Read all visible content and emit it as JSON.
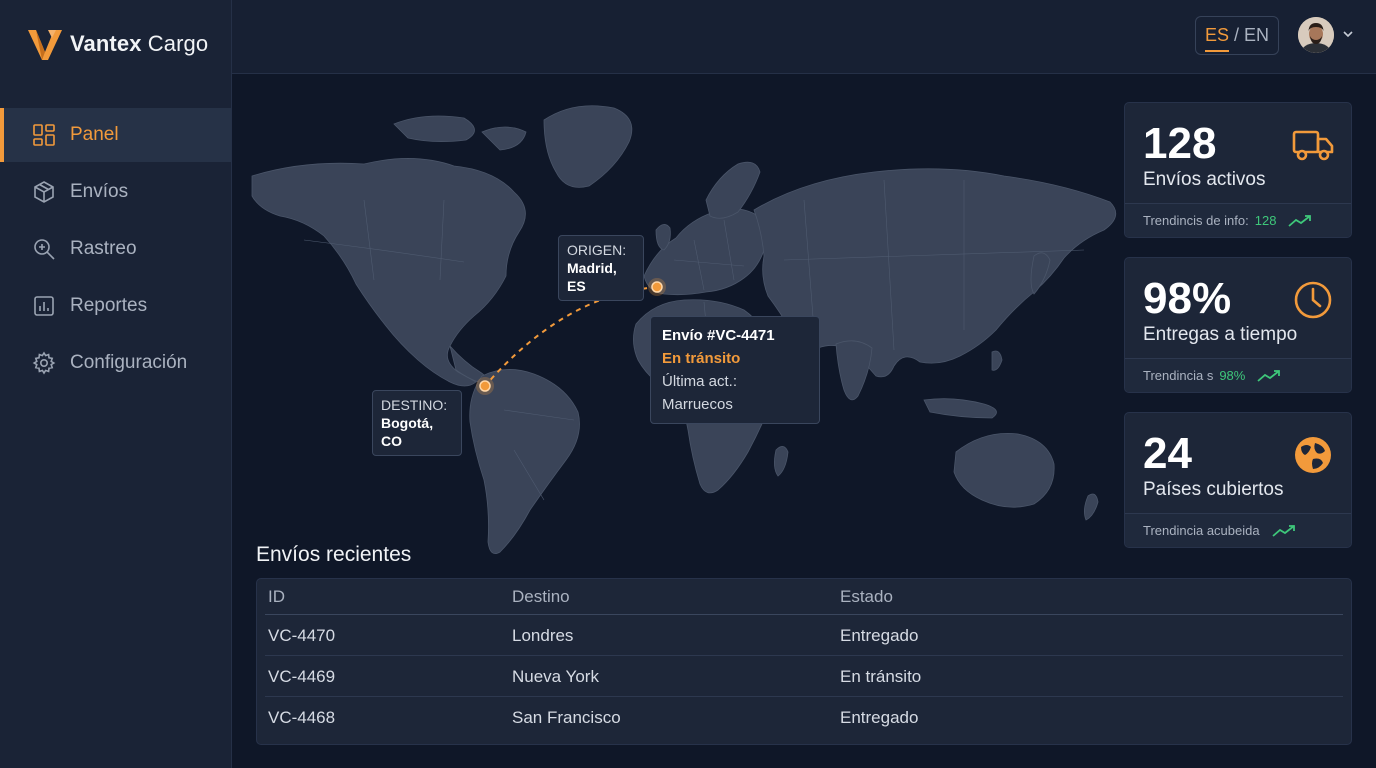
{
  "brand": {
    "name_bold": "Vantex",
    "name_rest": " Cargo",
    "accent": "#f29a3b"
  },
  "nav": [
    {
      "label": "Panel",
      "icon": "dashboard-icon",
      "active": true
    },
    {
      "label": "Envíos",
      "icon": "box-icon"
    },
    {
      "label": "Rastreo",
      "icon": "search-track-icon"
    },
    {
      "label": "Reportes",
      "icon": "report-icon"
    },
    {
      "label": "Configuración",
      "icon": "gear-icon"
    }
  ],
  "header": {
    "lang_es": "ES",
    "lang_sep": "/",
    "lang_en": "EN"
  },
  "map": {
    "origin": {
      "label": "ORIGEN:",
      "place": "Madrid, ES"
    },
    "destination": {
      "label": "DESTINO:",
      "place": "Bogotá, CO"
    },
    "shipment": {
      "title": "Envío #VC-4471",
      "status": "En tránsito",
      "last_update": "Última act.: Marruecos"
    }
  },
  "cards": [
    {
      "value": "128",
      "label": "Envíos activos",
      "foot_text": "Trendincis de info:",
      "foot_value": "128",
      "icon": "truck-icon"
    },
    {
      "value": "98%",
      "label": "Entregas a tiempo",
      "foot_text": "Trendincia s",
      "foot_value": "98%",
      "icon": "clock-icon"
    },
    {
      "value": "24",
      "label": "Países cubiertos",
      "foot_text": "Trendincia acubeida",
      "foot_value": "",
      "icon": "globe-icon"
    }
  ],
  "recent": {
    "title": "Envíos recientes",
    "columns": [
      "ID",
      "Destino",
      "Estado"
    ],
    "rows": [
      [
        "VC-4470",
        "Londres",
        "Entregado"
      ],
      [
        "VC-4469",
        "Nueva York",
        "En tránsito"
      ],
      [
        "VC-4468",
        "San Francisco",
        "Entregado"
      ]
    ]
  },
  "colors": {
    "positive": "#3ec77a",
    "bg": "#0f1728",
    "panel": "#1d2638"
  }
}
